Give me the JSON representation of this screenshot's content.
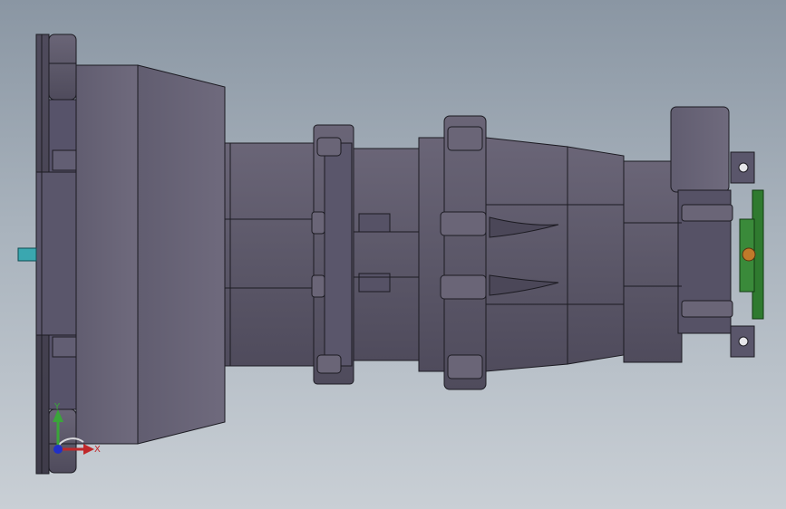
{
  "viewport": {
    "background_top": "#8a96a3",
    "background_bottom": "#c9cfd5"
  },
  "model": {
    "body_color": "#5e5a6b",
    "edge_color": "#1c1b22",
    "pcb_color": "#2f7a2f",
    "connector_color": "#3aa7b0",
    "bolt_color": "#c07a2a"
  },
  "triad": {
    "x_label": "X",
    "y_label": "Y",
    "x_color": "#c0282a",
    "y_color": "#3aa63a",
    "z_color": "#2030c8"
  }
}
